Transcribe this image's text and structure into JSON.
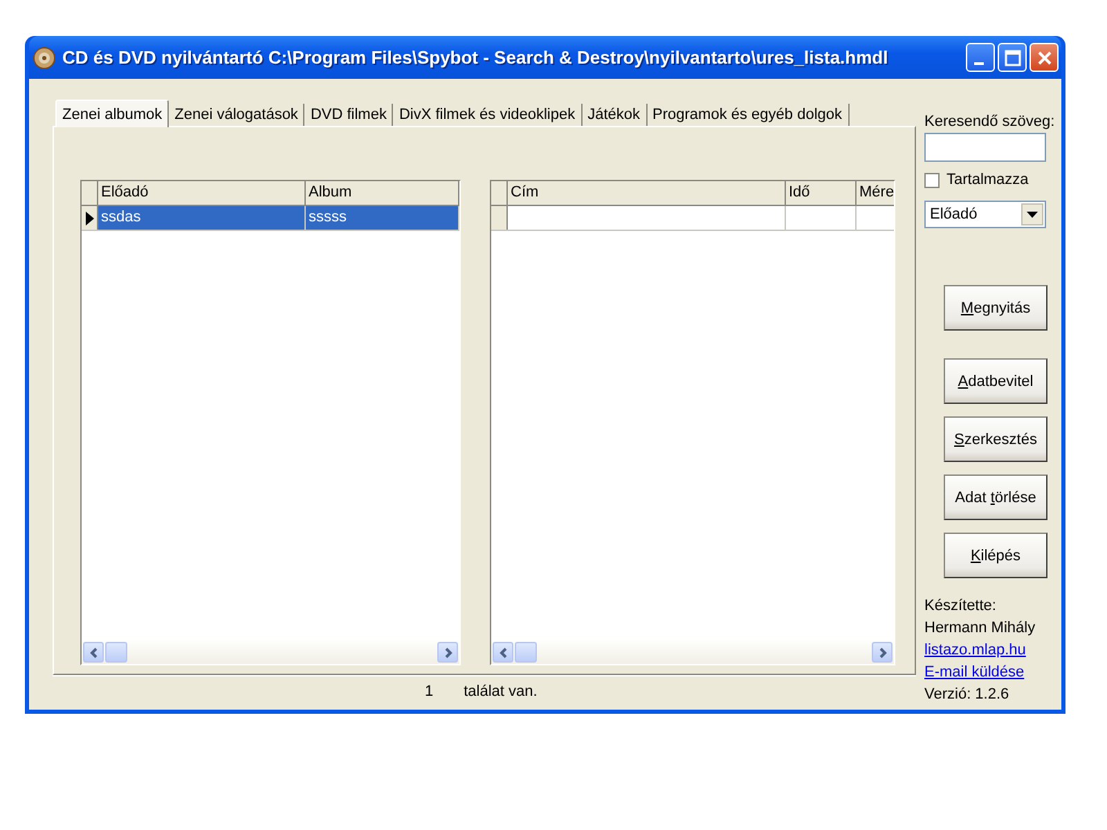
{
  "window": {
    "title": "CD és DVD nyilvántartó C:\\Program Files\\Spybot - Search & Destroy\\nyilvantarto\\ures_lista.hmdl"
  },
  "tabs": [
    {
      "label": "Zenei albumok",
      "selected": true
    },
    {
      "label": "Zenei válogatások",
      "selected": false
    },
    {
      "label": "DVD filmek",
      "selected": false
    },
    {
      "label": "DivX filmek és videoklipek",
      "selected": false
    },
    {
      "label": "Játékok",
      "selected": false
    },
    {
      "label": "Programok és egyéb dolgok",
      "selected": false
    }
  ],
  "album_table": {
    "columns": [
      "Előadó",
      "Album"
    ],
    "rows": [
      {
        "cells": [
          "ssdas",
          "sssss"
        ],
        "selected": true
      }
    ]
  },
  "track_table": {
    "columns": [
      "Cím",
      "Idő",
      "Mére"
    ],
    "blank_row": true
  },
  "search": {
    "label": "Keresendő szöveg:",
    "contains": {
      "label": "Tartalmazza",
      "checked": false
    },
    "field": {
      "value": "Előadó"
    }
  },
  "buttons": [
    {
      "key": "M",
      "post": "egnyitás"
    },
    {
      "key": "A",
      "post": "datbevitel"
    },
    {
      "key": "S",
      "post": "zerkesztés"
    },
    {
      "pre": "Adat ",
      "key": "t",
      "post": "örlése"
    },
    {
      "key": "K",
      "post": "ilépés"
    }
  ],
  "credits": {
    "author_label": "Készítette:",
    "author": "Hermann Mihály",
    "website": "listazo.mlap.hu",
    "email": "E-mail küldése",
    "version": "Verzió: 1.2.6"
  },
  "status_bar": {
    "count": "1",
    "text": "találat van."
  }
}
